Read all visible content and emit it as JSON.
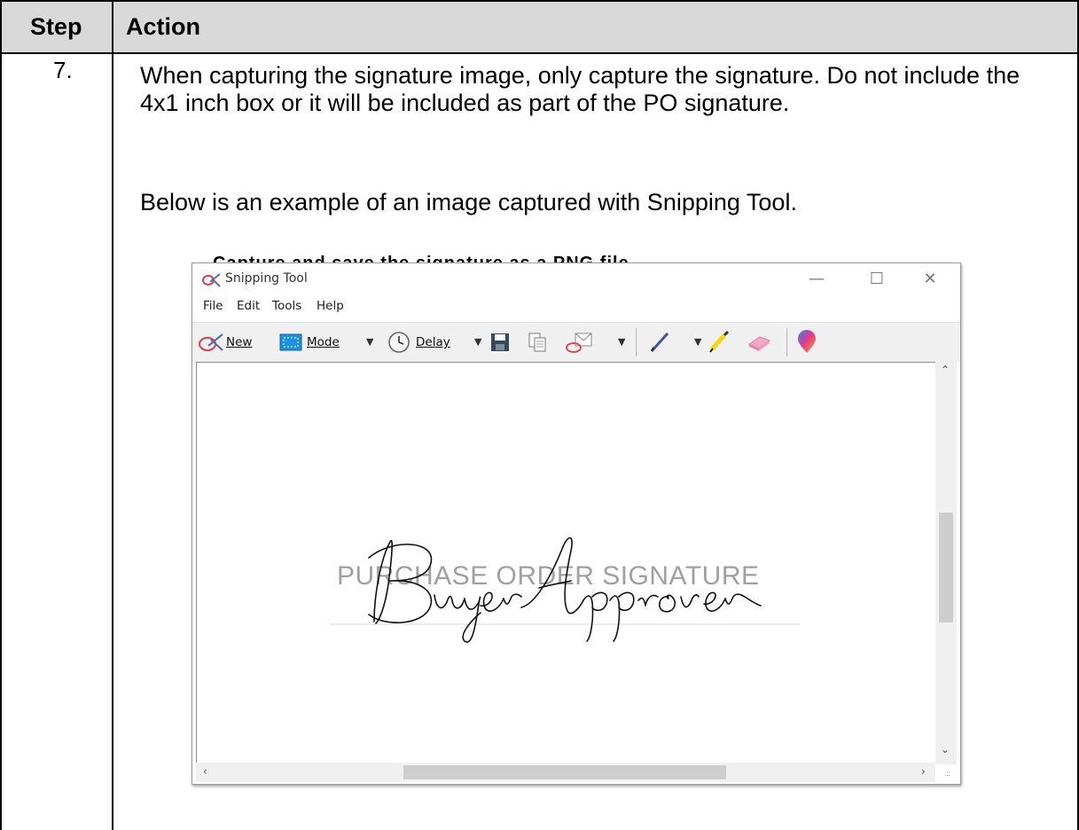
{
  "table": {
    "header_step": "Step",
    "header_action": "Action"
  },
  "row": {
    "step_number": "7.",
    "paragraph1": "When capturing the signature image, only capture the signature. Do not include the 4x1 inch box or it will be included as part of the PO signature.",
    "paragraph2": "Below is an example of an image captured with Snipping Tool."
  },
  "snipping_tool": {
    "title": "Snipping Tool",
    "menu": [
      "File",
      "Edit",
      "Tools",
      "Help"
    ],
    "toolbar": {
      "new_label": "New",
      "mode_label": "Mode",
      "delay_label": "Delay"
    },
    "canvas": {
      "placeholder_text": "PURCHASE ORDER SIGNATURE",
      "signature_text": "Buyer Approver"
    },
    "colors": {
      "accent": "#0078d7",
      "title_icon": "#e03c4b"
    }
  },
  "behind_text": "Capture and save the signature as a PNG file."
}
